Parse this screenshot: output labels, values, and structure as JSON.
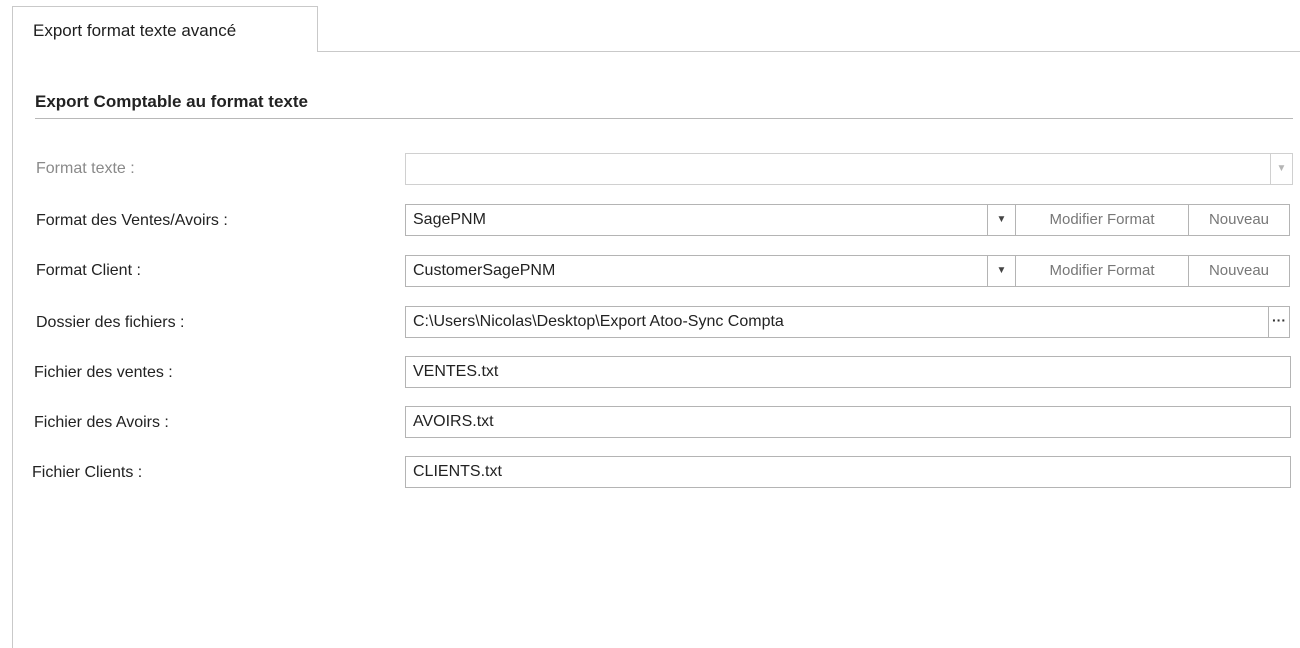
{
  "tab": {
    "label": "Export format texte avancé"
  },
  "section": {
    "title": "Export Comptable au format texte"
  },
  "rows": {
    "format_texte": {
      "label": "Format texte :",
      "value": ""
    },
    "format_ventes": {
      "label": "Format des Ventes/Avoirs :",
      "value": "SagePNM",
      "modify": "Modifier Format",
      "new": "Nouveau"
    },
    "format_client": {
      "label": "Format Client :",
      "value": "CustomerSagePNM",
      "modify": "Modifier Format",
      "new": "Nouveau"
    },
    "dossier": {
      "label": "Dossier des fichiers :",
      "value": "C:\\Users\\Nicolas\\Desktop\\Export Atoo-Sync Compta",
      "browse": "···"
    },
    "fichier_ventes": {
      "label": "Fichier des ventes :",
      "value": "VENTES.txt"
    },
    "fichier_avoirs": {
      "label": "Fichier des Avoirs :",
      "value": "AVOIRS.txt"
    },
    "fichier_clients": {
      "label": "Fichier Clients :",
      "value": "CLIENTS.txt"
    }
  },
  "icons": {
    "dropdown": "chevron-down-icon",
    "browse": "ellipsis-icon"
  }
}
